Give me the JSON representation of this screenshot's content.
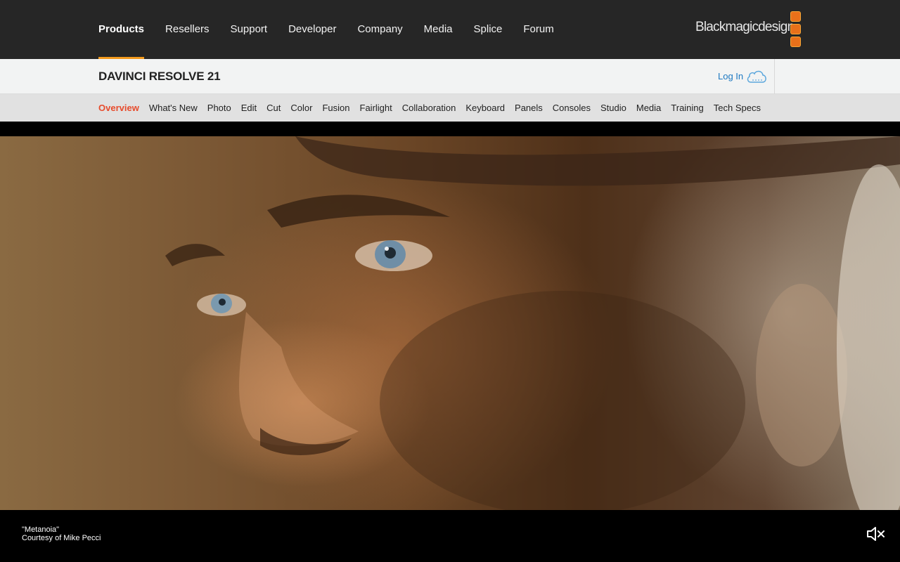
{
  "topnav": {
    "items": [
      {
        "label": "Products",
        "active": true
      },
      {
        "label": "Resellers"
      },
      {
        "label": "Support"
      },
      {
        "label": "Developer"
      },
      {
        "label": "Company"
      },
      {
        "label": "Media"
      },
      {
        "label": "Splice"
      },
      {
        "label": "Forum"
      }
    ],
    "logo_text": "Blackmagicdesign",
    "accent_color": "#f39a1d"
  },
  "productbar": {
    "title": "DAVINCI RESOLVE 21",
    "login_label": "Log In",
    "cloud_icon": "cloud-icon",
    "flag_icon": "us-flag-icon"
  },
  "subnav": {
    "items": [
      {
        "label": "Overview",
        "active": true
      },
      {
        "label": "What's New"
      },
      {
        "label": "Photo"
      },
      {
        "label": "Edit"
      },
      {
        "label": "Cut"
      },
      {
        "label": "Color"
      },
      {
        "label": "Fusion"
      },
      {
        "label": "Fairlight"
      },
      {
        "label": "Collaboration"
      },
      {
        "label": "Keyboard"
      },
      {
        "label": "Panels"
      },
      {
        "label": "Consoles"
      },
      {
        "label": "Studio"
      },
      {
        "label": "Media"
      },
      {
        "label": "Training"
      },
      {
        "label": "Tech Specs"
      }
    ],
    "active_color": "#e74b2c"
  },
  "video": {
    "caption_title": "\"Metanoia\"",
    "caption_credit": "Courtesy of Mike Pecci",
    "mute_icon": "speaker-muted-icon"
  }
}
